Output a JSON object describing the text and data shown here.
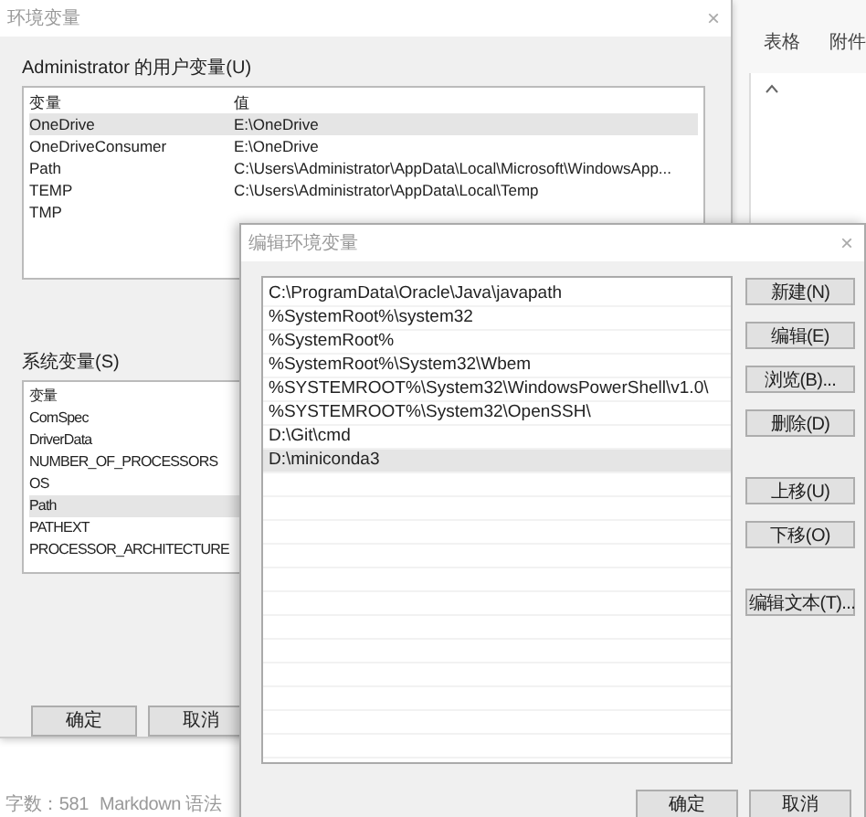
{
  "env_window": {
    "title": "环境变量",
    "close": "×",
    "user_section": {
      "label": "Administrator 的用户变量(U)",
      "columns": [
        "变量",
        "值"
      ],
      "rows": [
        {
          "name": "OneDrive",
          "value": "E:\\OneDrive",
          "selected": true
        },
        {
          "name": "OneDriveConsumer",
          "value": "E:\\OneDrive",
          "selected": false
        },
        {
          "name": "Path",
          "value": "C:\\Users\\Administrator\\AppData\\Local\\Microsoft\\WindowsApp...",
          "selected": false
        },
        {
          "name": "TEMP",
          "value": "C:\\Users\\Administrator\\AppData\\Local\\Temp",
          "selected": false
        },
        {
          "name": "TMP",
          "selected": false
        }
      ]
    },
    "system_section": {
      "label": "系统变量(S)",
      "columns": [
        "变量"
      ],
      "rows": [
        {
          "name": "ComSpec",
          "selected": false
        },
        {
          "name": "DriverData",
          "selected": false
        },
        {
          "name": "NUMBER_OF_PROCESSORS",
          "selected": false
        },
        {
          "name": "OS",
          "selected": false
        },
        {
          "name": "Path",
          "selected": true
        },
        {
          "name": "PATHEXT",
          "selected": false
        },
        {
          "name": "PROCESSOR_ARCHITECTURE",
          "selected": false
        }
      ]
    },
    "buttons": [
      "确定",
      "取消"
    ]
  },
  "side_panel": {
    "tabs": [
      "表格",
      "附件"
    ]
  },
  "status_bar": {
    "word_count": "字数：581",
    "mode": "Markdown 语法"
  },
  "edit_dialog": {
    "title": "编辑环境变量",
    "close": "×",
    "paths": [
      {
        "text": "C:\\ProgramData\\Oracle\\Java\\javapath",
        "selected": false
      },
      {
        "text": "%SystemRoot%\\system32",
        "selected": false
      },
      {
        "text": "%SystemRoot%",
        "selected": false
      },
      {
        "text": "%SystemRoot%\\System32\\Wbem",
        "selected": false
      },
      {
        "text": "%SYSTEMROOT%\\System32\\WindowsPowerShell\\v1.0\\",
        "selected": false
      },
      {
        "text": "%SYSTEMROOT%\\System32\\OpenSSH\\",
        "selected": false
      },
      {
        "text": "D:\\Git\\cmd",
        "selected": false
      },
      {
        "text": "D:\\miniconda3",
        "selected": true
      }
    ],
    "button_groups": [
      [
        "新建(N)",
        "编辑(E)",
        "浏览(B)...",
        "删除(D)"
      ],
      [
        "上移(U)",
        "下移(O)"
      ],
      [
        "编辑文本(T)..."
      ]
    ],
    "footer_buttons": [
      "确定",
      "取消"
    ]
  }
}
